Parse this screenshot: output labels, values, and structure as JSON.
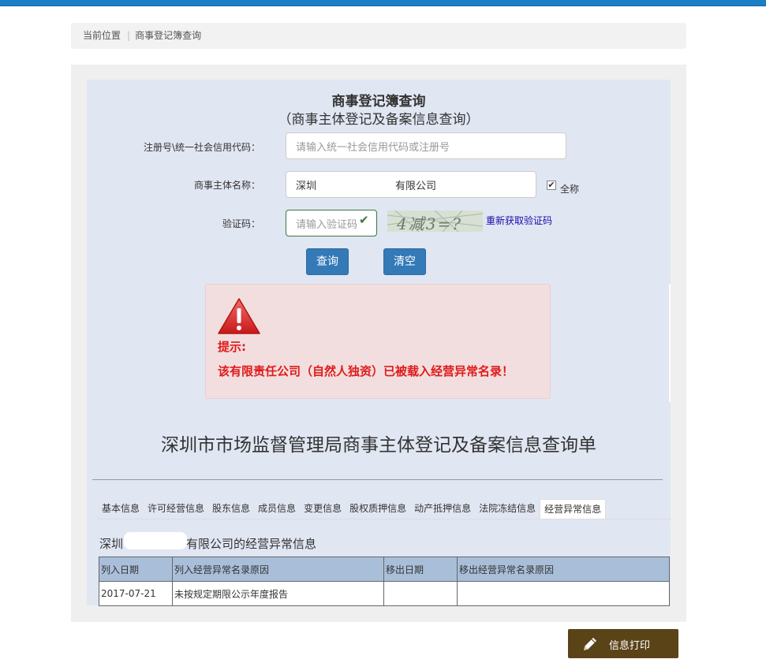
{
  "breadcrumb": {
    "label": "当前位置",
    "current": "商事登记簿查询"
  },
  "form": {
    "title": "商事登记簿查询",
    "subtitle": "（商事主体登记及备案信息查询）",
    "reg_label": "注册号\\统一社会信用代码：",
    "reg_placeholder": "请输入统一社会信用代码或注册号",
    "name_label": "商事主体名称：",
    "name_value_prefix": "深圳",
    "name_value_suffix": "有限公司",
    "fullname_checked": "✔",
    "fullname_label": "全称",
    "captcha_label": "验证码：",
    "captcha_placeholder": "请输入验证码",
    "captcha_image_text": "4减3=?",
    "refresh_link": "重新获取验证码",
    "search_button": "查询",
    "clear_button": "清空"
  },
  "alert": {
    "title": "提示:",
    "message": "该有限责任公司（自然人独资）已被载入经营异常名录！"
  },
  "doc_title": "深圳市市场监督管理局商事主体登记及备案信息查询单",
  "tabs": [
    "基本信息",
    "许可经营信息",
    "股东信息",
    "成员信息",
    "变更信息",
    "股权质押信息",
    "动产抵押信息",
    "法院冻结信息",
    "经营异常信息"
  ],
  "active_tab": "经营异常信息",
  "section": {
    "prefix": "深圳",
    "suffix": "有限公司的经营异常信息"
  },
  "table": {
    "headers": [
      "列入日期",
      "列入经营异常名录原因",
      "移出日期",
      "移出经营异常名录原因"
    ],
    "rows": [
      [
        "2017-07-21",
        "未按规定期限公示年度报告",
        "",
        ""
      ]
    ]
  },
  "print_button": "信息打印",
  "colors": {
    "topbar": "#1a7fc4",
    "button": "#337ab7",
    "alert_text": "#e01a1a",
    "print_button": "#5b4318"
  }
}
